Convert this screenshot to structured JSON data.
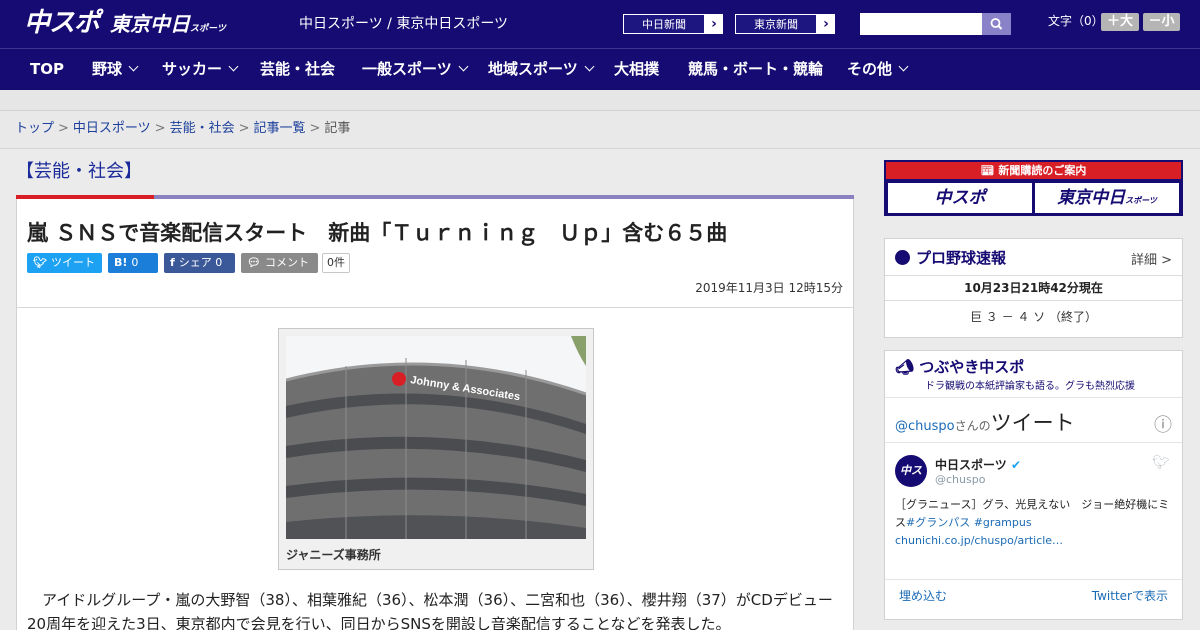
{
  "header": {
    "logo_main": "中スポ",
    "logo_sub": "東京中日",
    "logo_sub_small": "スポーツ",
    "site_names": "中日スポーツ / 東京中日スポーツ",
    "paper1": "中日新聞",
    "paper2": "東京新聞",
    "search_placeholder": "",
    "font_size_label": "文字（0）",
    "font_up": "＋大",
    "font_down": "－小"
  },
  "nav": [
    {
      "label": "TOP",
      "has_menu": false
    },
    {
      "label": "野球",
      "has_menu": true
    },
    {
      "label": "サッカー",
      "has_menu": true
    },
    {
      "label": "芸能・社会",
      "has_menu": false
    },
    {
      "label": "一般スポーツ",
      "has_menu": true
    },
    {
      "label": "地域スポーツ",
      "has_menu": true
    },
    {
      "label": "大相撲",
      "has_menu": false
    },
    {
      "label": "競馬・ボート・競輪",
      "has_menu": false
    },
    {
      "label": "その他",
      "has_menu": true
    }
  ],
  "breadcrumb": {
    "items": [
      "トップ",
      "中日スポーツ",
      "芸能・社会",
      "記事一覧"
    ],
    "current": "記事",
    "sep": ">"
  },
  "article": {
    "category": "【芸能・社会】",
    "title": "嵐 ＳＮＳで音楽配信スタート　新曲「Ｔｕｒｎｉｎｇ　Ｕｐ」含む６５曲",
    "share": {
      "tweet": "ツイート",
      "hatena_icon": "B!",
      "hatena_count": "0",
      "facebook": "シェア",
      "facebook_count": "0",
      "comment": "コメント",
      "comment_count": "0件"
    },
    "date": "2019年11月3日 12時15分",
    "photo_sign": "Johnny & Associates",
    "caption": "ジャニーズ事務所",
    "body": "アイドルグループ・嵐の大野智（38）、相葉雅紀（36）、松本潤（36）、二宮和也（36）、櫻井翔（37）がCDデビュー20周年を迎えた3日、東京都内で会見を行い、同日からSNSを開設し音楽配信することなどを発表した。"
  },
  "sidebar": {
    "promo": {
      "title": "新聞購読のご案内",
      "btn1": "中スポ",
      "btn2": "東京中日",
      "btn2_small": "スポーツ"
    },
    "baseball": {
      "title": "プロ野球速報",
      "detail": "詳細 >",
      "updated": "10月23日21時42分現在",
      "score": "巨 ３ － ４ ソ （終了）"
    },
    "tsubuyaki": {
      "title": "つぶやき中スポ",
      "subtitle": "ドラ観戦の本紙評論家も語る。グラも熱烈応援",
      "handle_link": "@chuspo",
      "handle_suffix": "さんの",
      "tweets_word": "ツイート",
      "info_icon": "ⓘ",
      "account_name": "中日スポーツ",
      "account_handle": "@chuspo",
      "tweet_text": "［グラニュース］グラ、光見えない　ジョー絶好機にミス",
      "hashtag1": "#グランパス",
      "hashtag2": "#grampus",
      "tweet_link": "chunichi.co.jp/chuspo/article…",
      "embed": "埋め込む",
      "view_on": "Twitterで表示"
    }
  },
  "colors": {
    "brand_navy": "#160b72",
    "accent_red": "#d81f26",
    "twitter_blue": "#1da1f2"
  }
}
